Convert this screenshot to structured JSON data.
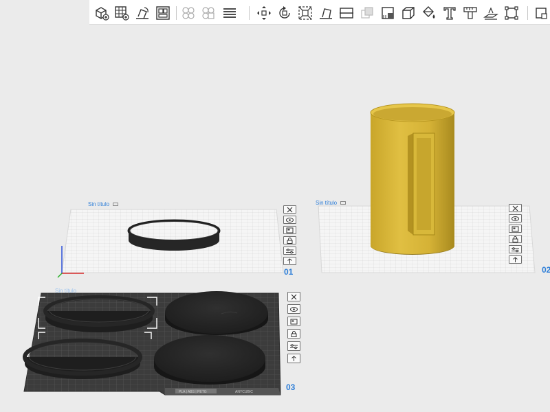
{
  "toolbar": {
    "tools": [
      {
        "name": "add-plate-tool",
        "icon": "cube-plus-icon"
      },
      {
        "name": "add-grid-plate-tool",
        "icon": "grid-plus-icon"
      },
      {
        "name": "auto-orient-tool",
        "icon": "orient-icon"
      },
      {
        "name": "auto-arrange-tool",
        "icon": "arrange-icon"
      },
      {
        "name": "split-objects-tool",
        "icon": "split-objects-icon"
      },
      {
        "name": "split-parts-tool",
        "icon": "split-parts-icon"
      },
      {
        "name": "layers-tool",
        "icon": "layers-icon"
      },
      {
        "name": "move-tool",
        "icon": "move-icon"
      },
      {
        "name": "rotate-tool",
        "icon": "rotate-icon"
      },
      {
        "name": "scale-tool",
        "icon": "scale-icon"
      },
      {
        "name": "lay-on-face-tool",
        "icon": "lay-on-face-icon"
      },
      {
        "name": "cut-tool",
        "icon": "cut-icon"
      },
      {
        "name": "boolean-tool",
        "icon": "boolean-icon"
      },
      {
        "name": "support-paint-tool",
        "icon": "support-paint-icon"
      },
      {
        "name": "seam-paint-tool",
        "icon": "seam-paint-icon"
      },
      {
        "name": "color-paint-tool",
        "icon": "color-paint-icon"
      },
      {
        "name": "text-tool",
        "icon": "text-icon"
      },
      {
        "name": "measure-tool",
        "icon": "measure-icon"
      },
      {
        "name": "emboss-tool",
        "icon": "emboss-icon"
      },
      {
        "name": "assembly-tool",
        "icon": "assembly-icon"
      }
    ]
  },
  "colors": {
    "model_yellow": "#d4b234",
    "model_black": "#242424",
    "plate_grid": "#cfcfcf",
    "accent": "#2f7fd8"
  },
  "plates": [
    {
      "name": "Sin título",
      "number": "01"
    },
    {
      "name": "Sin título",
      "number": "02"
    },
    {
      "name": "Sin título",
      "number": "03"
    }
  ],
  "plate_tools": [
    {
      "name": "remove-plate-tool",
      "icon": "close-icon"
    },
    {
      "name": "orient-plate-tool",
      "icon": "eye-icon"
    },
    {
      "name": "arrange-plate-tool",
      "icon": "arrange-icon"
    },
    {
      "name": "lock-plate-tool",
      "icon": "lock-icon"
    },
    {
      "name": "plate-settings-tool",
      "icon": "sliders-icon"
    },
    {
      "name": "plate-move-tool",
      "icon": "move-up-icon"
    }
  ],
  "plate3_label": {
    "filament": "PLA | ABS | PETG",
    "sheet": "ANYCUBIC"
  }
}
